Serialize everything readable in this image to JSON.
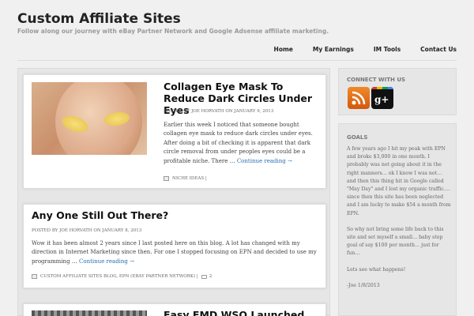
{
  "header": {
    "site_title": "Custom Affiliate Sites",
    "tagline": "Follow along our journey with eBay Partner Network and Google Adsense affiliate marketing."
  },
  "nav": {
    "items": [
      {
        "label": "Home"
      },
      {
        "label": "My Earnings"
      },
      {
        "label": "IM Tools"
      },
      {
        "label": "Contact Us"
      }
    ]
  },
  "posts": [
    {
      "title": "Collagen Eye Mask To Reduce Dark Circles Under Eyes",
      "meta": "POSTED BY JOE HORVATH ON JANUARY 9, 2013",
      "excerpt": "Earlier this week I noticed that someone bought collagen eye mask to reduce dark circles under eyes. After doing a bit of checking it is apparent that dark circle removal from under peoples eyes could be a profitable niche. There …",
      "continue": "Continue reading →",
      "categories": "NICHE IDEAS |",
      "image": "eye-mask-photo"
    },
    {
      "title": "Any One Still Out There?",
      "meta": "POSTED BY JOE HORVATH ON JANUARY 8, 2013",
      "excerpt": "Wow it has been almost 2 years since I last posted here on this blog. A lot has changed with my direction in Internet Marketing since then. For one I stopped focusing on EPN and decided to use my programming …",
      "continue": "Continue reading →",
      "categories": "CUSTOM AFFILIATE SITES BLOG, EPN (EBAY PARTNER NETWORK) |",
      "comments": "2"
    },
    {
      "title": "Easy EMD WSO Launched"
    }
  ],
  "sidebar": {
    "connect": {
      "title": "CONNECT WITH US",
      "icons": [
        "rss-icon",
        "google-plus-icon"
      ]
    },
    "goals": {
      "title": "GOALS",
      "paragraphs": [
        "A few years ago I hit my peak with EPN and broke $3,000 in one month. I probably was not going about it in the right manners… ok I know I was not… and then this thing hit in Google called \"May Day\" and I lost my organic traffic…. since then this site has been neglected and I am lucky to make $54 a month from EPN.",
        "So why not bring some life back to this site and set myself a small… baby step goal of say $100 per month… just for fun…",
        "Lets see what happens!",
        "-Joe 1/8/2013"
      ]
    }
  },
  "colors": {
    "link": "#2a6fb2",
    "rss": "#e8741c",
    "background": "#f0f0f0"
  }
}
